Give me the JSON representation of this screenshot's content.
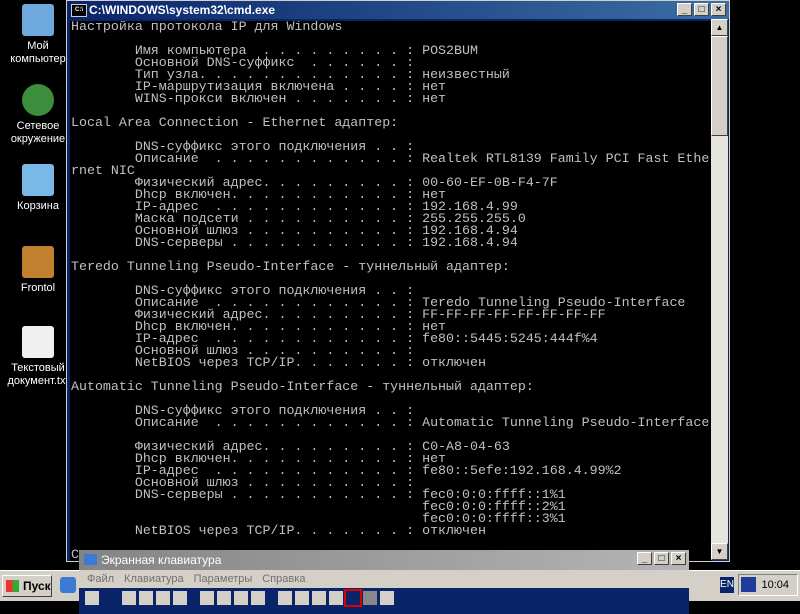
{
  "desktop": {
    "icons": [
      {
        "label": "Мой компьютер",
        "color": "#6fa8dc"
      },
      {
        "label": "Сетевое окружение",
        "color": "#3c8d3c"
      },
      {
        "label": "Корзина",
        "color": "#7ab8e8"
      },
      {
        "label": "Frontol",
        "color": "#c08030"
      },
      {
        "label": "Текстовый документ.txt",
        "color": "#f0f0f0"
      }
    ]
  },
  "cmd": {
    "title": "C:\\WINDOWS\\system32\\cmd.exe",
    "icon_text": "C:\\",
    "lines": [
      "Настройка протокола IP для Windows",
      "",
      "        Имя компьютера  . . . . . . . . . : POS2BUM",
      "        Основной DNS-суффикс  . . . . . . :",
      "        Тип узла. . . . . . . . . . . . . : неизвестный",
      "        IP-маршрутизация включена . . . . : нет",
      "        WINS-прокси включен . . . . . . . : нет",
      "",
      "Local Area Connection - Ethernet адаптер:",
      "",
      "        DNS-суффикс этого подключения . . :",
      "        Описание  . . . . . . . . . . . . : Realtek RTL8139 Family PCI Fast Ethe",
      "rnet NIC",
      "        Физический адрес. . . . . . . . . : 00-60-EF-0B-F4-7F",
      "        Dhcp включен. . . . . . . . . . . : нет",
      "        IP-адрес  . . . . . . . . . . . . : 192.168.4.99",
      "        Маска подсети . . . . . . . . . . : 255.255.255.0",
      "        Основной шлюз . . . . . . . . . . : 192.168.4.94",
      "        DNS-серверы . . . . . . . . . . . : 192.168.4.94",
      "",
      "Teredo Tunneling Pseudo-Interface - туннельный адаптер:",
      "",
      "        DNS-суффикс этого подключения . . :",
      "        Описание  . . . . . . . . . . . . : Teredo Tunneling Pseudo-Interface",
      "        Физический адрес. . . . . . . . . : FF-FF-FF-FF-FF-FF-FF-FF",
      "        Dhcp включен. . . . . . . . . . . : нет",
      "        IP-адрес  . . . . . . . . . . . . : fe80::5445:5245:444f%4",
      "        Основной шлюз . . . . . . . . . . :",
      "        NetBIOS через TCP/IP. . . . . . . : отключен",
      "",
      "Automatic Tunneling Pseudo-Interface - туннельный адаптер:",
      "",
      "        DNS-суффикс этого подключения . . :",
      "        Описание  . . . . . . . . . . . . : Automatic Tunneling Pseudo-Interface",
      "",
      "        Физический адрес. . . . . . . . . : C0-A8-04-63",
      "        Dhcp включен. . . . . . . . . . . : нет",
      "        IP-адрес  . . . . . . . . . . . . : fe80::5efe:192.168.4.99%2",
      "        Основной шлюз . . . . . . . . . . :",
      "        DNS-серверы . . . . . . . . . . . : fec0:0:0:ffff::1%1",
      "                                            fec0:0:0:ffff::2%1",
      "                                            fec0:0:0:ffff::3%1",
      "        NetBIOS через TCP/IP. . . . . . . : отключен",
      "",
      "C"
    ]
  },
  "osk": {
    "title": "Экранная клавиатура",
    "menu": [
      "Файл",
      "Клавиатура",
      "Параметры",
      "Справка"
    ]
  },
  "taskbar": {
    "start": "Пуск",
    "lang": "EN",
    "clock": "10:04"
  }
}
